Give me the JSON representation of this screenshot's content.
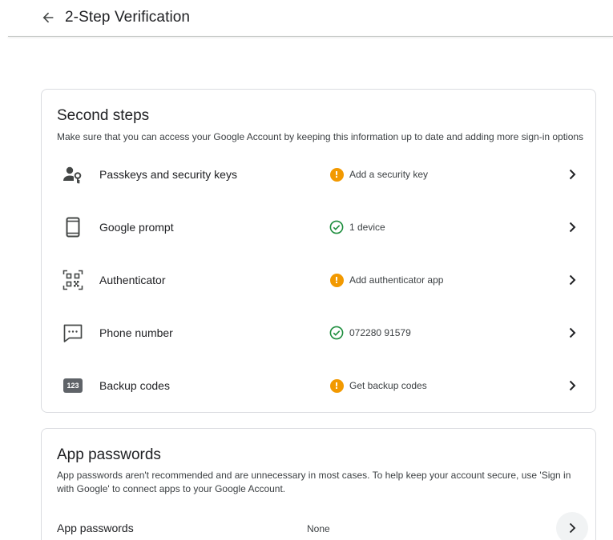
{
  "header": {
    "title": "2-Step Verification",
    "back_icon": "arrow-back-icon"
  },
  "second_steps": {
    "title": "Second steps",
    "description": "Make sure that you can access your Google Account by keeping this information up to date and adding more sign-in options",
    "items": [
      {
        "label": "Passkeys and security keys",
        "icon": "passkey-icon",
        "status": "Add a security key",
        "status_type": "warning"
      },
      {
        "label": "Google prompt",
        "icon": "phone-icon",
        "status": "1 device",
        "status_type": "ok"
      },
      {
        "label": "Authenticator",
        "icon": "qr-code-icon",
        "status": "Add authenticator app",
        "status_type": "warning"
      },
      {
        "label": "Phone number",
        "icon": "sms-icon",
        "status": "072280 91579",
        "status_type": "ok"
      },
      {
        "label": "Backup codes",
        "icon": "backup-codes-icon",
        "icon_text": "123",
        "status": "Get backup codes",
        "status_type": "warning"
      }
    ]
  },
  "app_passwords": {
    "title": "App passwords",
    "description": "App passwords aren't recommended and are unnecessary in most cases. To help keep your account secure, use 'Sign in with Google' to connect apps to your Google Account.",
    "row_label": "App passwords",
    "row_value": "None"
  },
  "colors": {
    "warning": "#f29900",
    "ok": "#1e8e3e",
    "icon": "#5f6368",
    "text": "#202124"
  }
}
